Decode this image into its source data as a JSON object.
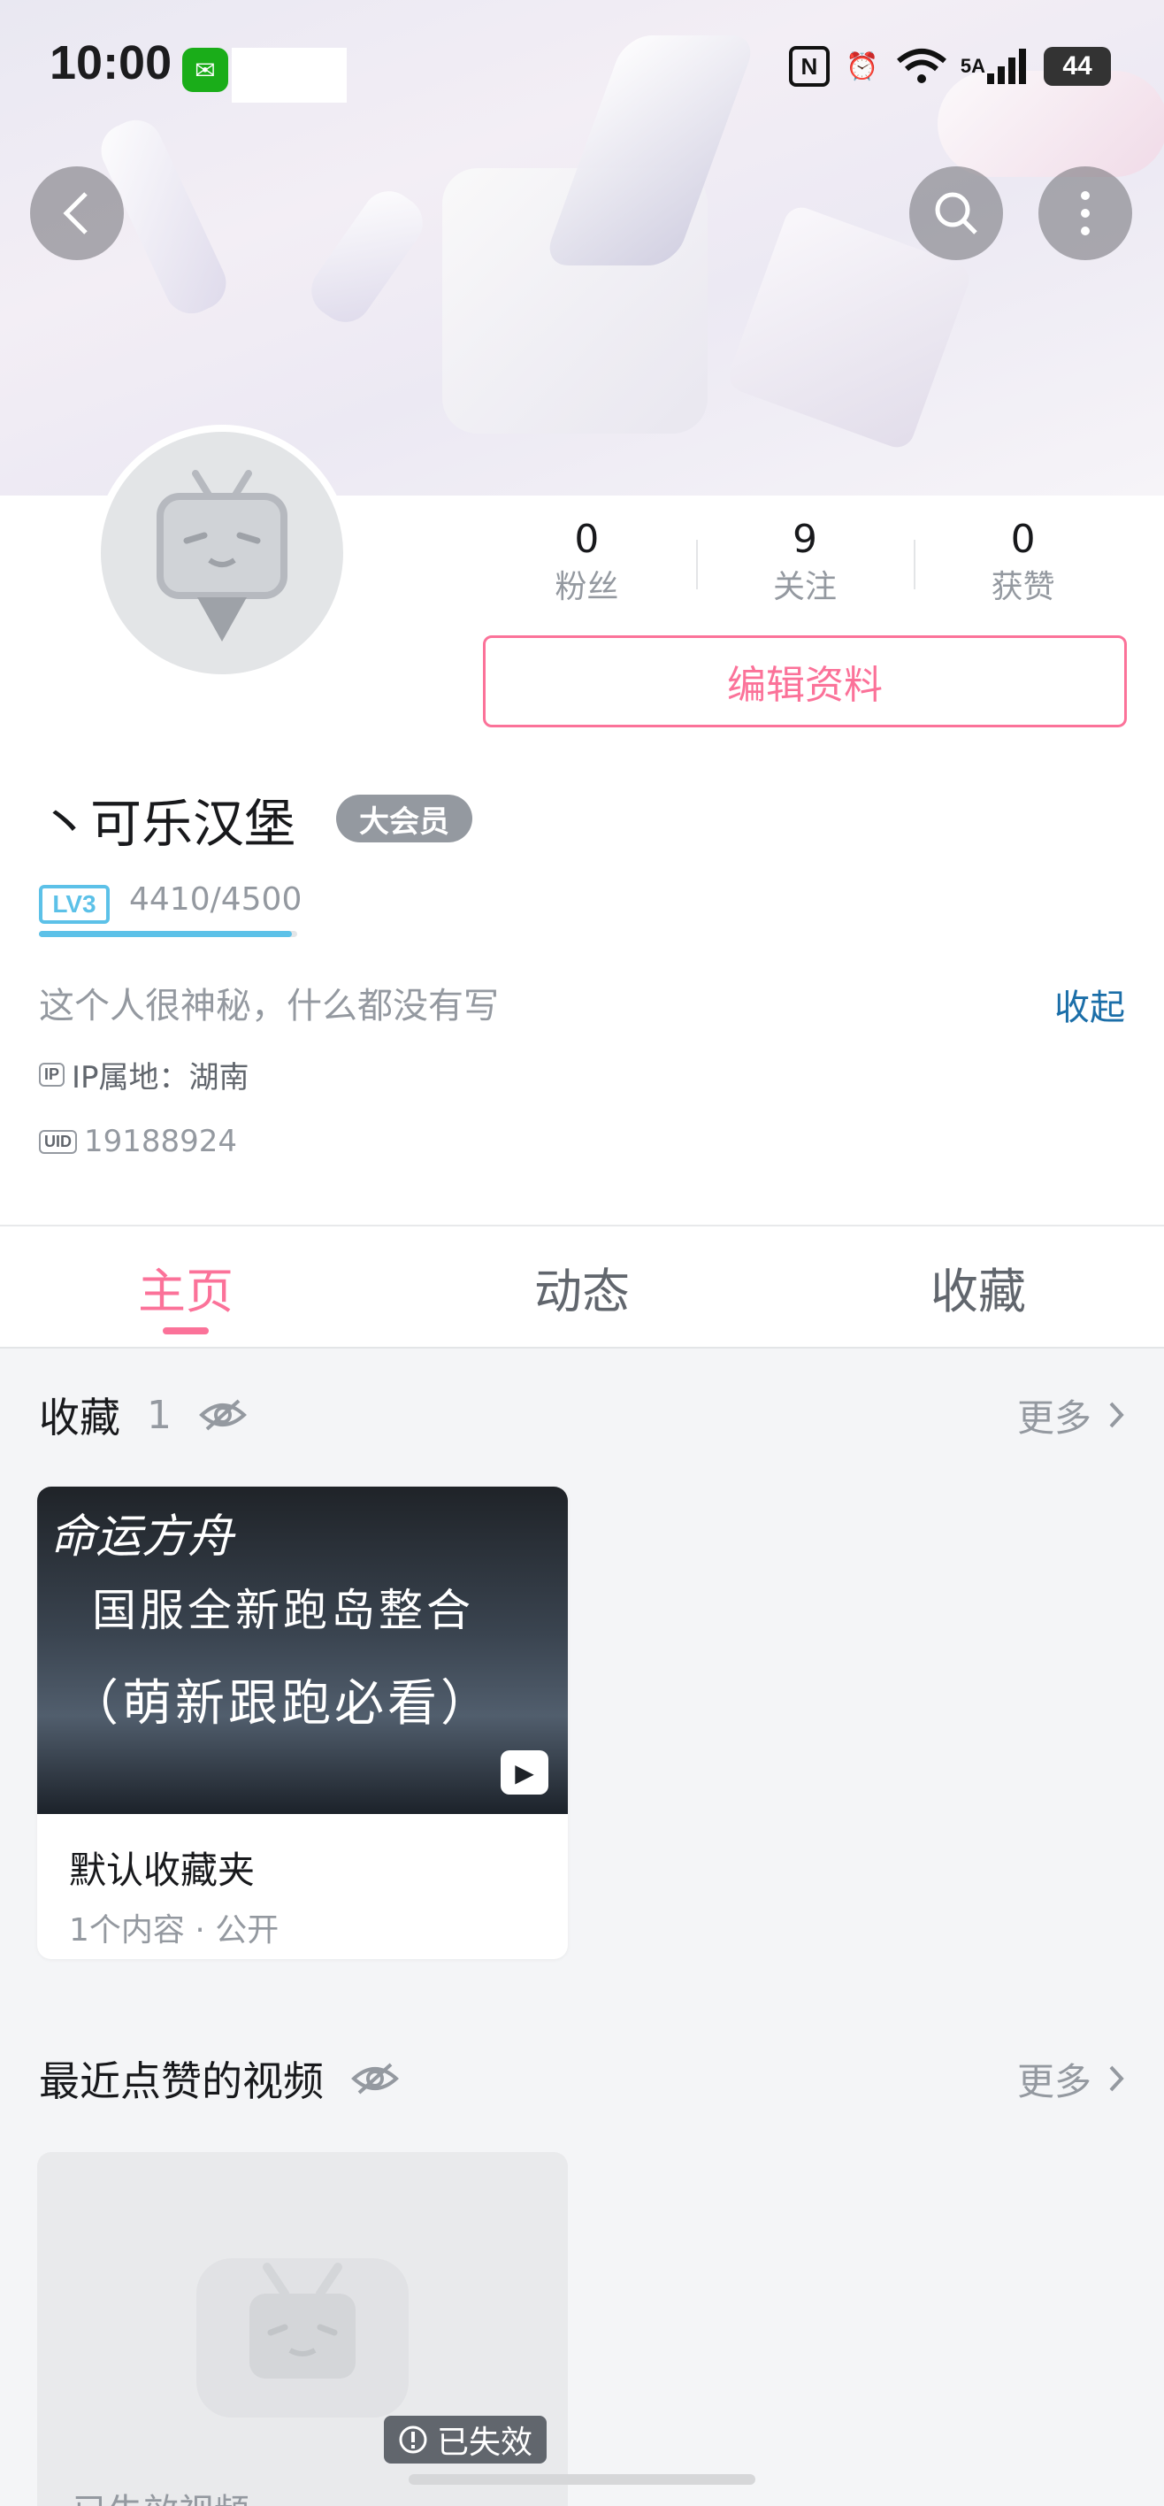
{
  "status_bar": {
    "time": "10:00",
    "network": "5A",
    "wifi_label": "6",
    "battery": "44"
  },
  "profile": {
    "stats": [
      {
        "value": "0",
        "label": "粉丝"
      },
      {
        "value": "9",
        "label": "关注"
      },
      {
        "value": "0",
        "label": "获赞"
      }
    ],
    "edit_label": "编辑资料",
    "username": "丶可乐汉堡",
    "vip_label": "大会员",
    "level": "LV3",
    "level_badge": "LV3",
    "exp_text": "4410/4500",
    "exp_progress": 0.98,
    "bio": "这个人很神秘，什么都没有写",
    "collapse_label": "收起",
    "ip_text": "IP属地：湖南",
    "ip_icon": "IP",
    "uid_icon": "UID",
    "uid_text": "19188924"
  },
  "tabs": [
    {
      "label": "主页",
      "active": true
    },
    {
      "label": "动态",
      "active": false
    },
    {
      "label": "收藏",
      "active": false
    }
  ],
  "favorites": {
    "title": "收藏",
    "count": "1",
    "more_label": "更多",
    "card": {
      "cover_lines": [
        "命运方舟",
        "国服全新跑岛整合",
        "（萌新跟跑必看）"
      ],
      "name": "默认收藏夹",
      "meta": "1个内容 · 公开"
    }
  },
  "liked": {
    "title": "最近点赞的视频",
    "more_label": "更多",
    "invalid_label": "已失效",
    "peek_title": "已失效视频"
  },
  "colors": {
    "accent": "#fb7299",
    "level": "#5cc1e8",
    "link": "#1b6ea8"
  }
}
